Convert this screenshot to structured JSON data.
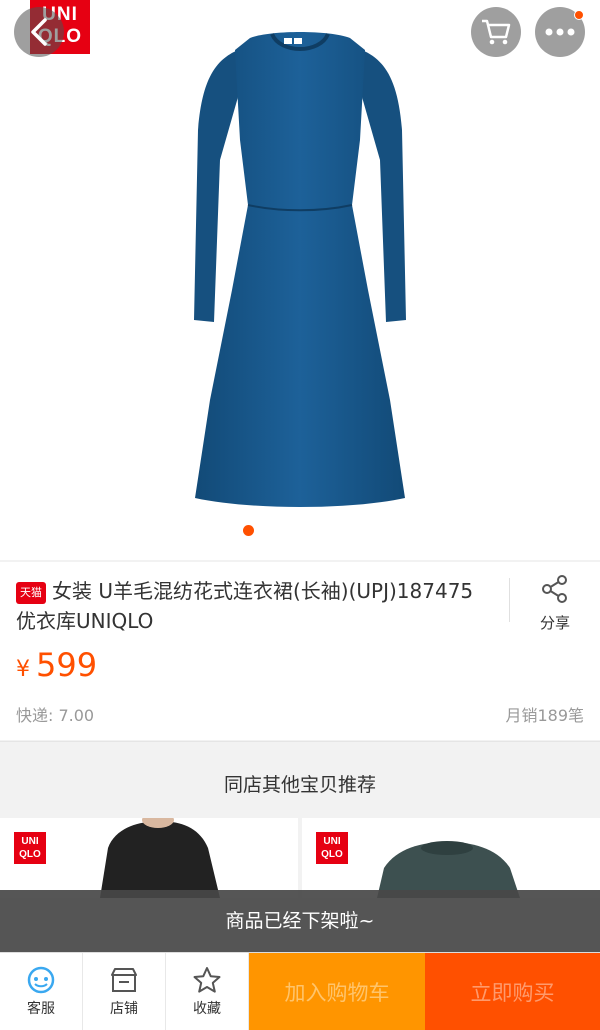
{
  "header": {
    "brand_logo_line1": "UNI",
    "brand_logo_line2": "QLO",
    "back_icon": "chevron-left-icon",
    "cart_icon": "shopping-cart-icon",
    "more_icon": "ellipsis-icon"
  },
  "gallery": {
    "image": "blue-knit-dress",
    "page_count": 1,
    "current_page": 1
  },
  "product": {
    "platform_badge": "天猫",
    "title": "女装 U羊毛混纺花式连衣裙(长袖)(UPJ)187475 优衣库UNIQLO",
    "share_label": "分享",
    "price_symbol": "¥",
    "price": "599",
    "shipping": "快递: 7.00",
    "monthly_sales": "月销189笔"
  },
  "recommendations": {
    "header": "同店其他宝贝推荐",
    "logo_line1": "UNI",
    "logo_line2": "QLO"
  },
  "toast": {
    "message": "商品已经下架啦~"
  },
  "bottom_bar": {
    "service_label": "客服",
    "store_label": "店铺",
    "favorite_label": "收藏",
    "add_to_cart_label": "加入购物车",
    "buy_now_label": "立即购买"
  },
  "colors": {
    "accent": "#ff5000",
    "add_to_cart": "#ff9500",
    "brand_red": "#e60012",
    "dress_blue": "#1b5a8c"
  }
}
